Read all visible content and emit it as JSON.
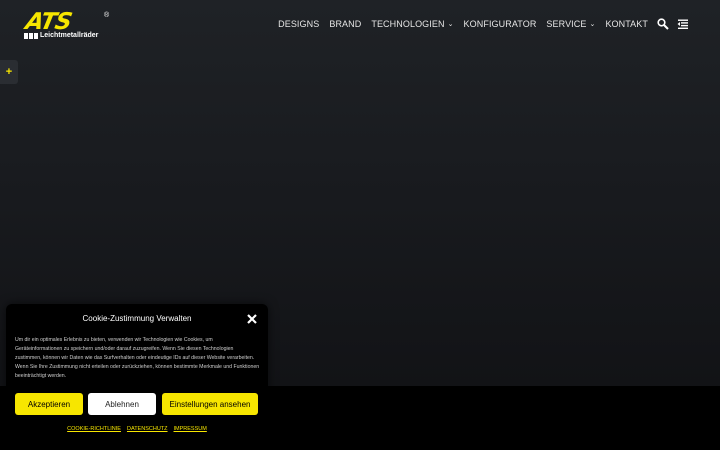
{
  "brand": {
    "logo_text": "ATS",
    "registered": "®",
    "subtitle": "Leichtmetallräder"
  },
  "nav": {
    "items": [
      {
        "label": "DESIGNS",
        "dropdown": false
      },
      {
        "label": "BRAND",
        "dropdown": false
      },
      {
        "label": "TECHNOLOGIEN",
        "dropdown": true
      },
      {
        "label": "KONFIGURATOR",
        "dropdown": false
      },
      {
        "label": "SERVICE",
        "dropdown": true
      },
      {
        "label": "KONTAKT",
        "dropdown": false
      }
    ],
    "search_icon": "search-icon",
    "menu_icon": "menu-icon"
  },
  "side_tab": {
    "symbol": "+"
  },
  "cookie": {
    "title": "Cookie-Zustimmung Verwalten",
    "text": "Um dir ein optimales Erlebnis zu bieten, verwenden wir Technologien wie Cookies, um Geräteinformationen zu speichern und/oder darauf zuzugreifen. Wenn Sie diesen Technologien zustimmen, können wir Daten wie das Surfverhalten oder eindeutige IDs auf dieser Website verarbeiten. Wenn Sie Ihre Zustimmung nicht erteilen oder zurückziehen, können bestimmte Merkmale und Funktionen beeinträchtigt werden.",
    "accept_label": "Akzeptieren",
    "deny_label": "Ablehnen",
    "settings_label": "Einstellungen ansehen",
    "links": [
      "COOKIE-RICHTLINIE",
      "DATENSCHUTZ",
      "IMPRESSUM"
    ]
  },
  "colors": {
    "accent": "#f7e600",
    "background": "#000000"
  }
}
